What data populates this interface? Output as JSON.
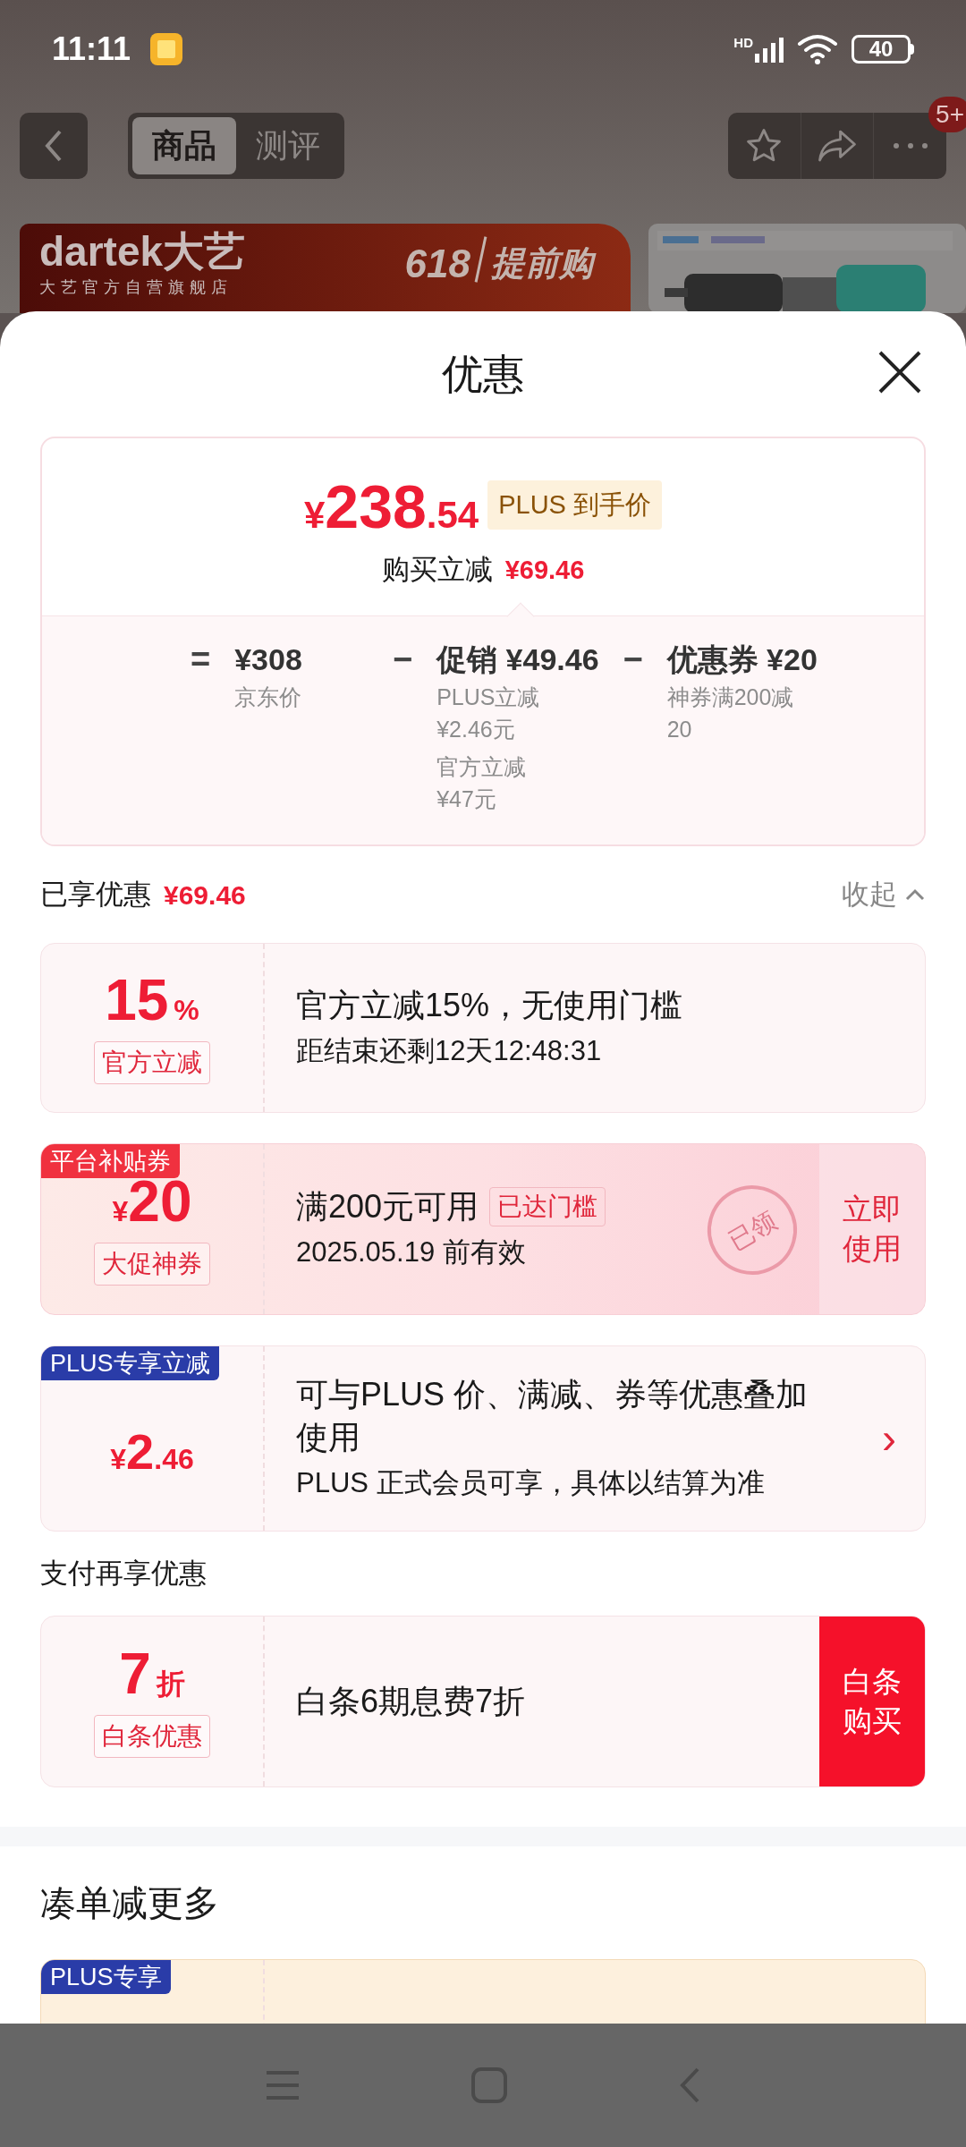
{
  "status_bar": {
    "time": "11:11",
    "network": "HD",
    "battery": "40"
  },
  "top_bar": {
    "tabs": [
      {
        "label": "商品",
        "selected": true
      },
      {
        "label": "测评",
        "selected": false
      }
    ],
    "badge": "5+"
  },
  "banner": {
    "logo": "dartek大艺",
    "store": "大艺官方自营旗舰店",
    "event": "618",
    "slogan": "提前购"
  },
  "sheet": {
    "title": "优惠"
  },
  "price_card": {
    "currency": "¥",
    "price_int": "238",
    "price_dec": ".54",
    "tag": "PLUS 到手价",
    "saving_label": "购买立减",
    "saving": "¥69.46",
    "breakdown": [
      {
        "op": "=",
        "amount": "¥308",
        "notes": [
          "京东价"
        ]
      },
      {
        "op": "−",
        "amount": "促销 ¥49.46",
        "notes": [
          "PLUS立减¥2.46元",
          "官方立减¥47元"
        ]
      },
      {
        "op": "−",
        "amount": "优惠券 ¥20",
        "notes": [
          "神券满200减20"
        ]
      }
    ]
  },
  "applied": {
    "label": "已享优惠",
    "amount": "¥69.46",
    "toggle": "收起",
    "expanded": true
  },
  "offers": [
    {
      "kind": "discount",
      "value": "15",
      "unit": "%",
      "tag": "官方立减",
      "title": "官方立减15%，无使用门槛",
      "subtitle": "距结束还剩12天12:48:31"
    },
    {
      "kind": "coupon",
      "corner": "平台补贴券",
      "currency": "¥",
      "value": "20",
      "tag": "大促神券",
      "title": "满200元可用",
      "badge": "已达门槛",
      "subtitle": "2025.05.19 前有效",
      "action": "立即使用",
      "stamp": "已领"
    },
    {
      "kind": "plus",
      "corner": "PLUS专享立减",
      "currency": "¥",
      "value": "2",
      "decimal": ".46",
      "title": "可与PLUS 价、满减、券等优惠叠加使用",
      "subtitle": "PLUS 正式会员可享，具体以结算为准",
      "arrow": "›"
    }
  ],
  "pay_section": {
    "title": "支付再享优惠",
    "offers": [
      {
        "kind": "pay",
        "value": "7",
        "unit": "折",
        "tag": "白条优惠",
        "title": "白条6期息费7折",
        "action": "白条购买"
      }
    ]
  },
  "more_section": {
    "title": "凑单减更多",
    "offers": [
      {
        "kind": "gold",
        "corner": "PLUS专享"
      }
    ]
  }
}
